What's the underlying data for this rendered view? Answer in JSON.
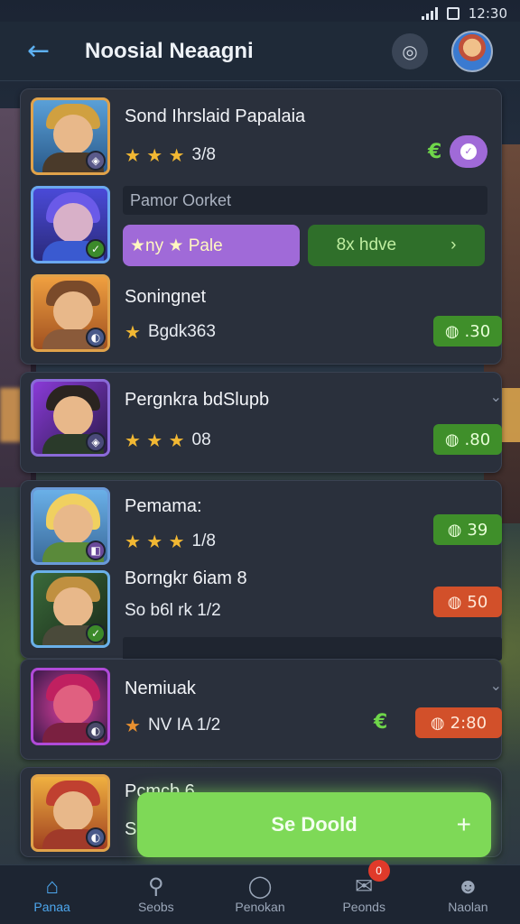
{
  "status": {
    "time": "12:30"
  },
  "header": {
    "title": "Noosial Neaagni"
  },
  "items": [
    {
      "name": "Sond Ihrslaid Papalaia",
      "stars": "★ ★ ★",
      "meta": "3/8",
      "currency": "€"
    },
    {
      "search_placeholder": "Pamor Oorket",
      "btn_left": "★ny ★ Pale",
      "btn_right": "8x hdve",
      "btn_right_chev": "›"
    },
    {
      "name": "Soningnet",
      "stars": "★",
      "meta": "Bgdk363",
      "price": ".30"
    },
    {
      "name": "Pergnkra bdSlupb",
      "stars": "★ ★ ★",
      "meta": "08",
      "price": ".80"
    },
    {
      "name": "Pemama:",
      "stars": "★ ★ ★",
      "meta": "1/8",
      "price": "39"
    },
    {
      "name": "Borngkr 6iam 8",
      "meta": "So b6l rk 1/2",
      "price": "50"
    },
    {
      "name": "Nemiuak",
      "stars": "★",
      "meta": "NV IA 1/2",
      "currency": "€",
      "price": "2:80"
    },
    {
      "name": "Pcmcb 6 ...",
      "meta": "S"
    }
  ],
  "cta": {
    "label": "Se Doold",
    "plus": "+"
  },
  "nav": [
    {
      "label": "Panaa"
    },
    {
      "label": "Seobs"
    },
    {
      "label": "Penokan"
    },
    {
      "label": "Peonds",
      "badge": "0"
    },
    {
      "label": "Naolan"
    }
  ],
  "colors": {
    "accent": "#4da7ee",
    "green": "#3f8f2a",
    "cta": "#7ed957",
    "red": "#d2502a",
    "purple": "#a06ad8"
  }
}
